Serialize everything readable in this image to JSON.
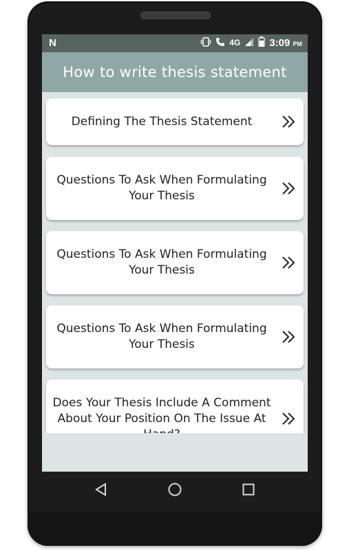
{
  "status_bar": {
    "notification_icon": "N",
    "network_type": "4G",
    "time": "3:09",
    "ampm": "PM"
  },
  "app_bar": {
    "title": "How to write thesis statement"
  },
  "list": {
    "items": [
      {
        "label": "Defining The Thesis Statement"
      },
      {
        "label": "Questions To Ask When Formulating Your Thesis"
      },
      {
        "label": "Questions To Ask When Formulating Your Thesis"
      },
      {
        "label": "Questions To Ask When Formulating Your Thesis"
      },
      {
        "label": "Does Your Thesis Include A Comment About Your Position On The Issue At Hand?"
      }
    ]
  },
  "icons": {
    "chevron": "double-chevron-right-icon",
    "nav_back": "back-triangle-icon",
    "nav_home": "home-circle-icon",
    "nav_recents": "recents-square-icon"
  },
  "colors": {
    "status_bar": "#56635f",
    "app_bar": "#8fa8a6",
    "background": "#dde4e4",
    "card": "#ffffff",
    "text": "#222222"
  }
}
